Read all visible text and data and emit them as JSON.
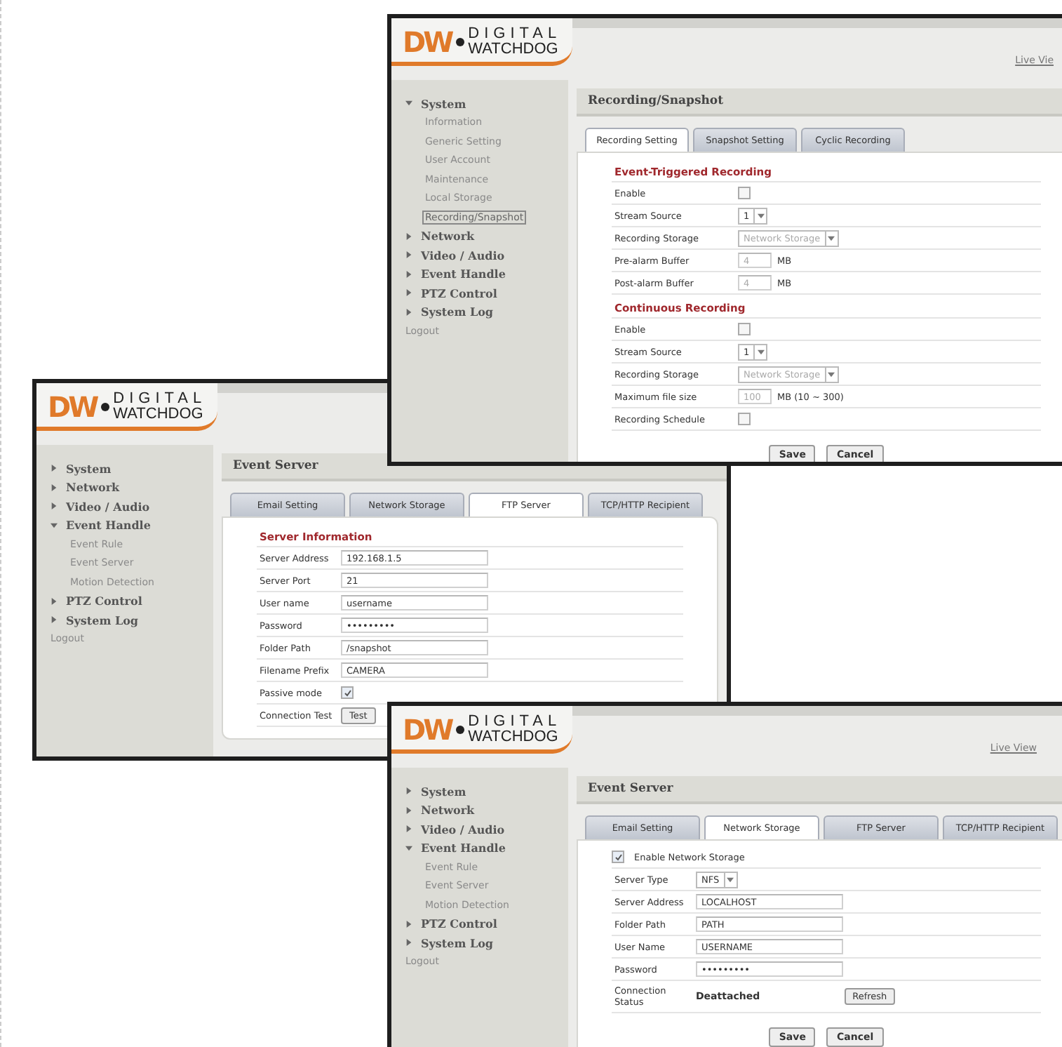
{
  "windows": [
    {
      "logo": {
        "mark": "DW",
        "line1": "DIGITAL",
        "line2": "WATCHDOG"
      },
      "header_link": "Live Vie",
      "sidebar": [
        {
          "label": "System",
          "expanded": true,
          "children": [
            {
              "label": "Information",
              "selected": false
            },
            {
              "label": "Generic Setting",
              "selected": false
            },
            {
              "label": "User Account",
              "selected": false
            },
            {
              "label": "Maintenance",
              "selected": false
            },
            {
              "label": "Local Storage",
              "selected": false
            },
            {
              "label": "Recording/Snapshot",
              "selected": true
            }
          ]
        },
        {
          "label": "Network",
          "expanded": false
        },
        {
          "label": "Video / Audio",
          "expanded": false
        },
        {
          "label": "Event Handle",
          "expanded": false
        },
        {
          "label": "PTZ Control",
          "expanded": false
        },
        {
          "label": "System Log",
          "expanded": false
        }
      ],
      "logout": "Logout",
      "page_title": "Recording/Snapshot",
      "tabs": [
        {
          "label": "Recording Setting",
          "selected": true
        },
        {
          "label": "Snapshot Setting",
          "selected": false
        },
        {
          "label": "Cyclic Recording",
          "selected": false
        }
      ],
      "sections": [
        {
          "title": "Event-Triggered Recording",
          "rows": [
            {
              "kind": "checkbox",
              "label": "Enable",
              "checked": false
            },
            {
              "kind": "select",
              "label": "Stream Source",
              "value": "1",
              "disabled": false
            },
            {
              "kind": "select",
              "label": "Recording Storage",
              "value": "Network Storage",
              "disabled": true
            },
            {
              "kind": "number",
              "label": "Pre-alarm Buffer",
              "value": "4",
              "unit": "MB",
              "disabled": true
            },
            {
              "kind": "number",
              "label": "Post-alarm Buffer",
              "value": "4",
              "unit": "MB",
              "disabled": true
            }
          ]
        },
        {
          "title": "Continuous Recording",
          "rows": [
            {
              "kind": "checkbox",
              "label": "Enable",
              "checked": false
            },
            {
              "kind": "select",
              "label": "Stream Source",
              "value": "1",
              "disabled": false
            },
            {
              "kind": "select",
              "label": "Recording Storage",
              "value": "Network Storage",
              "disabled": true
            },
            {
              "kind": "number",
              "label": "Maximum file size",
              "value": "100",
              "unit": "MB (10 ~ 300)",
              "disabled": true
            },
            {
              "kind": "checkbox",
              "label": "Recording Schedule",
              "checked": false
            }
          ]
        }
      ],
      "buttons": [
        "Save",
        "Cancel"
      ]
    },
    {
      "logo": {
        "mark": "DW",
        "line1": "DIGITAL",
        "line2": "WATCHDOG"
      },
      "sidebar": [
        {
          "label": "System",
          "expanded": false
        },
        {
          "label": "Network",
          "expanded": false
        },
        {
          "label": "Video / Audio",
          "expanded": false
        },
        {
          "label": "Event Handle",
          "expanded": true,
          "children": [
            {
              "label": "Event Rule",
              "selected": false
            },
            {
              "label": "Event Server",
              "selected": false
            },
            {
              "label": "Motion Detection",
              "selected": false
            }
          ]
        },
        {
          "label": "PTZ Control",
          "expanded": false
        },
        {
          "label": "System Log",
          "expanded": false
        }
      ],
      "logout": "Logout",
      "page_title": "Event Server",
      "tabs": [
        {
          "label": "Email Setting",
          "selected": false
        },
        {
          "label": "Network Storage",
          "selected": false
        },
        {
          "label": "FTP Server",
          "selected": true
        },
        {
          "label": "TCP/HTTP Recipient",
          "selected": false
        }
      ],
      "sections": [
        {
          "title": "Server Information",
          "rows": [
            {
              "kind": "text",
              "label": "Server Address",
              "value": "192.168.1.5"
            },
            {
              "kind": "text",
              "label": "Server Port",
              "value": "21"
            },
            {
              "kind": "text",
              "label": "User name",
              "value": "username"
            },
            {
              "kind": "text",
              "label": "Password",
              "value": "•••••••••"
            },
            {
              "kind": "text",
              "label": "Folder Path",
              "value": "/snapshot"
            },
            {
              "kind": "text",
              "label": "Filename Prefix",
              "value": "CAMERA"
            },
            {
              "kind": "checkbox",
              "label": "Passive mode",
              "checked": true
            },
            {
              "kind": "button",
              "label": "Connection Test",
              "button": "Test"
            }
          ]
        }
      ]
    },
    {
      "logo": {
        "mark": "DW",
        "line1": "DIGITAL",
        "line2": "WATCHDOG"
      },
      "header_link": "Live View",
      "sidebar": [
        {
          "label": "System",
          "expanded": false
        },
        {
          "label": "Network",
          "expanded": false
        },
        {
          "label": "Video / Audio",
          "expanded": false
        },
        {
          "label": "Event Handle",
          "expanded": true,
          "children": [
            {
              "label": "Event Rule",
              "selected": false
            },
            {
              "label": "Event Server",
              "selected": false
            },
            {
              "label": "Motion Detection",
              "selected": false
            }
          ]
        },
        {
          "label": "PTZ Control",
          "expanded": false
        },
        {
          "label": "System Log",
          "expanded": false
        }
      ],
      "logout": "Logout",
      "page_title": "Event Server",
      "tabs": [
        {
          "label": "Email Setting",
          "selected": false
        },
        {
          "label": "Network Storage",
          "selected": true
        },
        {
          "label": "FTP Server",
          "selected": false
        },
        {
          "label": "TCP/HTTP Recipient",
          "selected": false
        }
      ],
      "sections": [
        {
          "rows": [
            {
              "kind": "inline_checkbox",
              "label": "Enable Network Storage",
              "checked": true
            },
            {
              "kind": "select",
              "label": "Server Type",
              "value": "NFS",
              "disabled": false
            },
            {
              "kind": "text",
              "label": "Server Address",
              "value": "LOCALHOST"
            },
            {
              "kind": "text",
              "label": "Folder Path",
              "value": "PATH"
            },
            {
              "kind": "text",
              "label": "User Name",
              "value": "USERNAME"
            },
            {
              "kind": "text",
              "label": "Password",
              "value": "•••••••••"
            },
            {
              "kind": "status",
              "label": "Connection Status",
              "value": "Deattached",
              "button": "Refresh"
            }
          ]
        }
      ],
      "buttons": [
        "Save",
        "Cancel"
      ]
    }
  ]
}
